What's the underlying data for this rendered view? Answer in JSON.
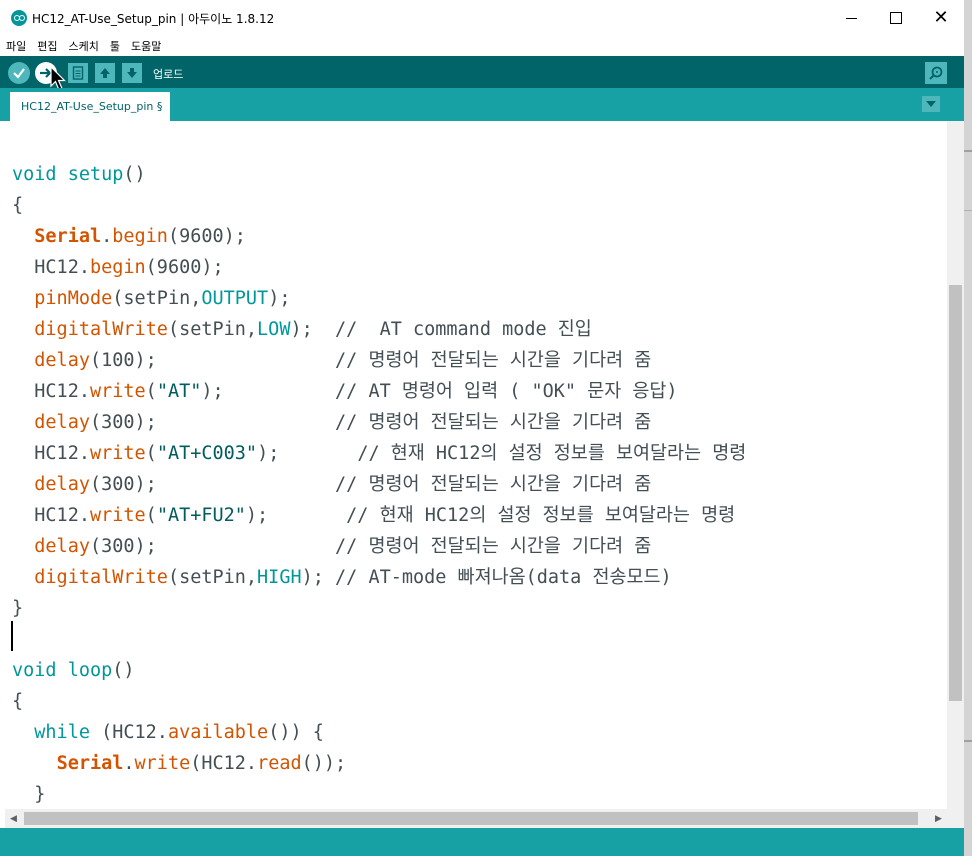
{
  "window": {
    "title": "HC12_AT-Use_Setup_pin | 아두이노 1.8.12"
  },
  "menu": [
    "파일",
    "편집",
    "스케치",
    "툴",
    "도움말"
  ],
  "toolbar": {
    "hover_label": "업로드",
    "icons": [
      "verify-icon",
      "upload-icon",
      "new-icon",
      "open-icon",
      "save-icon",
      "serial-monitor-icon"
    ]
  },
  "tab": {
    "label": "HC12_AT-Use_Setup_pin §"
  },
  "colors": {
    "toolbar": "#006468",
    "tabbar": "#17a1a5",
    "keyword": "#00979c",
    "function": "#d35400",
    "string": "#005c5f"
  },
  "code": {
    "lines": [
      "void setup()",
      "{",
      "  Serial.begin(9600);",
      "  HC12.begin(9600);",
      "  pinMode(setPin,OUTPUT);",
      "  digitalWrite(setPin,LOW);  //  AT command mode 진입",
      "  delay(100);                // 명령어 전달되는 시간을 기다려 줌",
      "  HC12.write(\"AT\");          // AT 명령어 입력 ( \"OK\" 문자 응답)",
      "  delay(300);                // 명령어 전달되는 시간을 기다려 줌",
      "  HC12.write(\"AT+C003\");       // 현재 HC12의 설정 정보를 보여달라는 명령",
      "  delay(300);                // 명령어 전달되는 시간을 기다려 줌",
      "  HC12.write(\"AT+FU2\");       // 현재 HC12의 설정 정보를 보여달라는 명령",
      "  delay(300);                // 명령어 전달되는 시간을 기다려 줌",
      "  digitalWrite(setPin,HIGH); // AT-mode 빠져나옴(data 전송모드)",
      "}",
      "",
      "void loop()",
      "{",
      "  while (HC12.available()) {",
      "    Serial.write(HC12.read());",
      "  }"
    ]
  }
}
